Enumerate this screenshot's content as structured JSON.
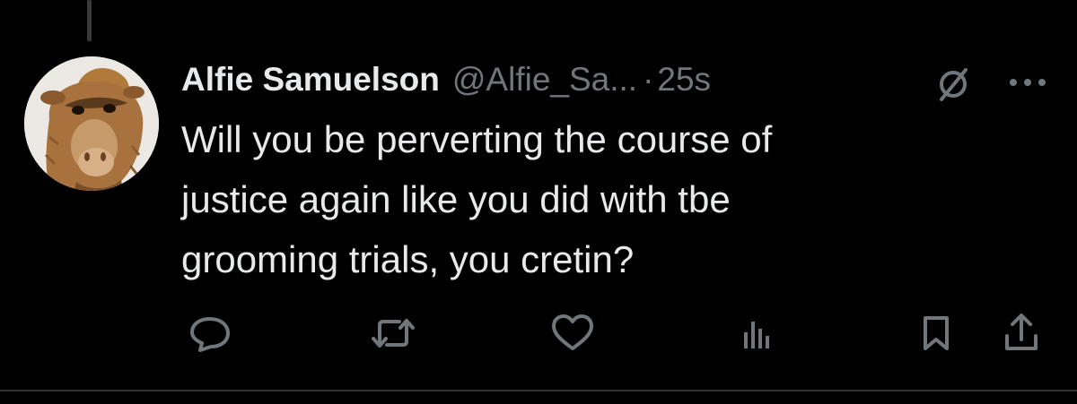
{
  "tweet": {
    "author": {
      "display_name": "Alfie Samuelson",
      "handle": "@Alfie_Sa...",
      "avatar_icon": "alf-avatar"
    },
    "separator": "·",
    "timestamp": "25s",
    "text_lines": [
      "Will you be perverting the course of",
      "justice again like you did with tbe",
      "grooming trials, you cretin?"
    ]
  },
  "header_icons": [
    "grok-icon",
    "more-icon"
  ],
  "actions": [
    "reply-icon",
    "retweet-icon",
    "like-icon",
    "views-icon",
    "bookmark-icon",
    "share-icon"
  ],
  "colors": {
    "background": "#000000",
    "primary_text": "#e7e9ea",
    "secondary_text": "#71767b",
    "divider": "#2f3336"
  }
}
